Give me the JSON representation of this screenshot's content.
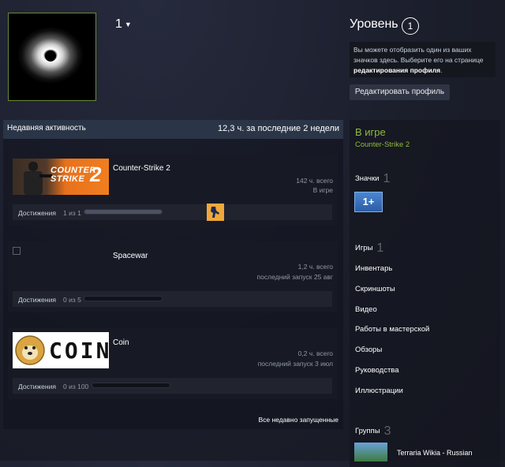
{
  "profile": {
    "persona_name": "1",
    "avatar_icon": "black-hole-avatar-icon"
  },
  "level": {
    "title": "Уровень",
    "value": "1",
    "info_text": "Вы можете отобразить один из ваших значков здесь. Выберите его на странице ",
    "info_link": "редактирования профиля",
    "info_end": ".",
    "edit_button": "Редактировать профиль"
  },
  "activity": {
    "title": "Недавняя активность",
    "hours_summary": "12,3 ч. за последние 2 недели",
    "achievements_label": "Достижения",
    "games": [
      {
        "name": "Counter-Strike 2",
        "hours_total": "142 ч. всего",
        "status": "В игре",
        "achievements": "1 из 1",
        "progress": 1.0,
        "art_line1": "COUNTER",
        "art_line2": "STRIKE",
        "art_num": "2"
      },
      {
        "name": "Spacewar",
        "hours_total": "1,2 ч. всего",
        "status": "последний запуск 25 авг",
        "achievements": "0 из 5",
        "progress": 0.0
      },
      {
        "name": "Coin",
        "hours_total": "0,2 ч. всего",
        "status": "последний запуск 3 июл",
        "achievements": "0 из 100",
        "progress": 0.0,
        "art_word": "COIN"
      }
    ],
    "all_recent_link": "Все недавно запущенные"
  },
  "sidebar": {
    "status": "В игре",
    "status_game": "Counter-Strike 2",
    "badges_label": "Значки",
    "badges_count": "1",
    "badge_text": "1+",
    "games_label": "Игры",
    "games_count": "1",
    "links": [
      "Инвентарь",
      "Скриншоты",
      "Видео",
      "Работы в мастерской",
      "Обзоры",
      "Руководства",
      "Иллюстрации"
    ],
    "groups_label": "Группы",
    "groups_count": "3",
    "group_name": "Terraria Wikia - Russian"
  },
  "colors": {
    "ingame_green": "#90ba3c",
    "header_blue": "#2a3547",
    "link_white": "#ffffff"
  }
}
